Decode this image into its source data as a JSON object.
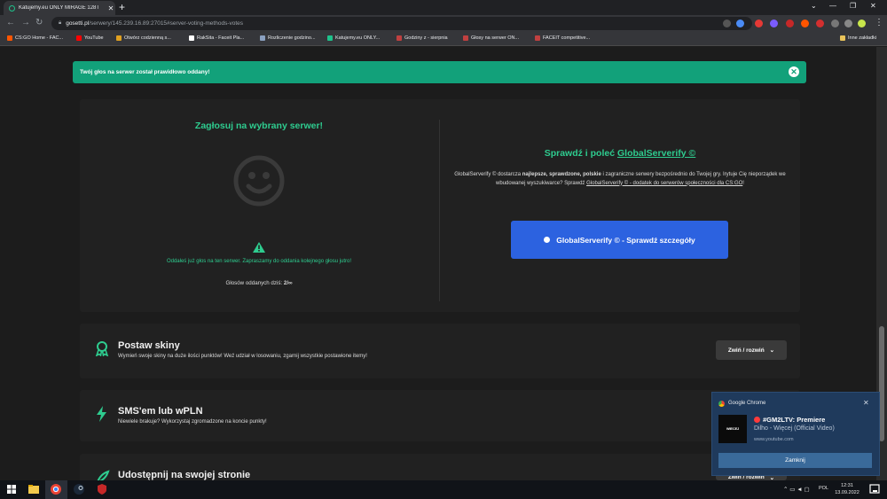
{
  "browser": {
    "tab_title": "Katujemy.eu ONLY MIRAGE 128T",
    "new_tab": "+",
    "url_domain": "gosetti.pl",
    "url_path": "/serwery/145.239.16.89:27015#server-voting-methods-votes",
    "bookmarks": [
      {
        "label": "CS:GO Home - FAC...",
        "color": "#ff5500"
      },
      {
        "label": "YouTube",
        "color": "#ff0000"
      },
      {
        "label": "Otwórz codzienną s...",
        "color": "#e0a020"
      },
      {
        "label": "RakSita - Faceit Pla...",
        "color": "#ffffff"
      },
      {
        "label": "Rozliczenie godzino...",
        "color": "#8aa0c0"
      },
      {
        "label": "Katujemy.eu ONLY...",
        "color": "#1ec28b"
      },
      {
        "label": "Godziny z - sierpnia",
        "color": "#c04040"
      },
      {
        "label": "Głosy na serwer ON...",
        "color": "#c04040"
      },
      {
        "label": "FACEIT competitive...",
        "color": "#c04040"
      }
    ],
    "other_bookmarks": "Inne zakładki"
  },
  "alert": {
    "message": "Twój głos na serwer został prawidłowo oddany!"
  },
  "vote": {
    "title": "Zagłosuj na wybrany serwer!",
    "message": "Oddałeś już głos na ten serwer. Zapraszamy do oddania kolejnego głosu jutro!",
    "count_label": "Głosów oddanych dziś:",
    "count_value": "2/∞"
  },
  "globalserverify": {
    "title_prefix": "Sprawdź i poleć",
    "title_link": "GlobalServerify ©",
    "text_1": "GlobalServerify © dostarcza",
    "text_bold": "najlepsze, sprawdzone, polskie",
    "text_2": "i zagraniczne serwery bezpośrednio do Twojej gry. Irytuje Cię nieporządek we wbudowanej wyszukiwarce? Sprawdź",
    "text_link": "GlobalServerify © - dodatek do serwerów społeczności dla CS:GO",
    "text_end": "!",
    "button_label": "GlobalServerify © - Sprawdź szczegóły"
  },
  "sections": [
    {
      "title": "Postaw skiny",
      "description": "Wymień swoje skiny na duże ilości punktów! Weź udział w losowaniu, zgarnij wszystkie postawione itemy!",
      "toggle": "Zwiń / rozwiń"
    },
    {
      "title": "SMS'em lub wPLN",
      "description": "Niewiele brakuje? Wykorzystaj zgromadzone na koncie punkty!"
    },
    {
      "title": "Udostępnij na swojej stronie",
      "toggle": "Zwiń / rozwiń"
    }
  ],
  "notification": {
    "app": "Google Chrome",
    "title": "#GM2LTV: Premiere",
    "subtitle": "Dilho - Więcej (Official Video)",
    "url": "www.youtube.com",
    "thumb_text": "WIECEJ",
    "button": "Zamknij"
  },
  "taskbar": {
    "lang": "POL",
    "time": "12:31",
    "date": "13.09.2022"
  },
  "colors": {
    "accent_green": "#2ecc8f",
    "alert_green": "#12a17a",
    "button_blue": "#2c62e0",
    "card_bg": "#212121",
    "page_bg": "#1c1c1c"
  }
}
